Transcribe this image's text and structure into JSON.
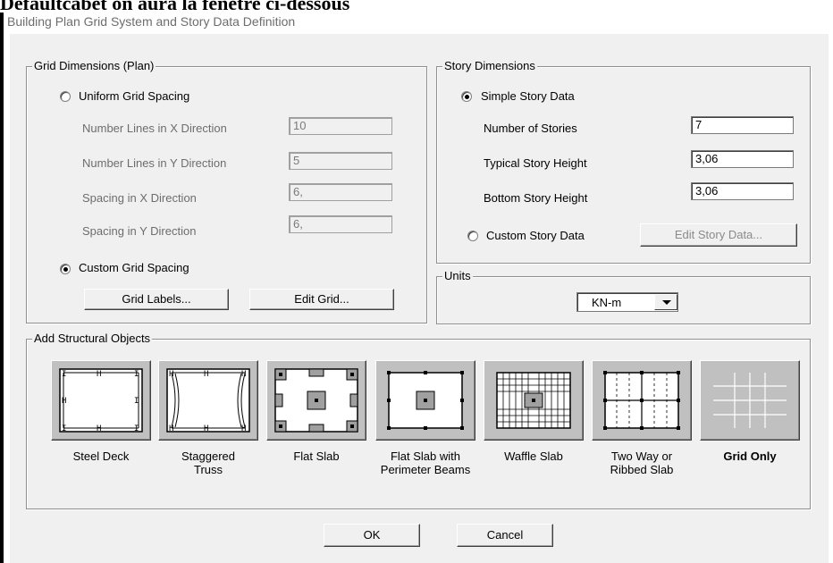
{
  "caption": "Défaultcabet on aura la fenêtre ci-dessous",
  "window_title": "Building Plan Grid System and Story Data Definition",
  "grid_dimensions": {
    "title": "Grid Dimensions (Plan)",
    "uniform_label": "Uniform Grid Spacing",
    "uniform_selected": false,
    "fields": [
      {
        "label": "Number Lines in X Direction",
        "value": "10"
      },
      {
        "label": "Number Lines in Y Direction",
        "value": "5"
      },
      {
        "label": "Spacing in X Direction",
        "value": "6,"
      },
      {
        "label": "Spacing in Y Direction",
        "value": "6,"
      }
    ],
    "custom_label": "Custom Grid Spacing",
    "custom_selected": true,
    "grid_labels_button": "Grid Labels...",
    "edit_grid_button": "Edit Grid..."
  },
  "story_dimensions": {
    "title": "Story Dimensions",
    "simple_label": "Simple Story Data",
    "simple_selected": true,
    "fields": [
      {
        "label": "Number of Stories",
        "value": "7"
      },
      {
        "label": "Typical Story Height",
        "value": "3,06"
      },
      {
        "label": "Bottom Story Height",
        "value": "3,06"
      }
    ],
    "custom_label": "Custom Story Data",
    "custom_selected": false,
    "edit_story_button": "Edit Story Data..."
  },
  "units": {
    "title": "Units",
    "selected": "KN-m"
  },
  "structural_objects": {
    "title": "Add Structural Objects",
    "items": [
      {
        "line1": "Steel Deck",
        "line2": "",
        "icon": "steel-deck-icon"
      },
      {
        "line1": "Staggered",
        "line2": "Truss",
        "icon": "staggered-truss-icon"
      },
      {
        "line1": "Flat Slab",
        "line2": "",
        "icon": "flat-slab-icon"
      },
      {
        "line1": "Flat Slab with",
        "line2": "Perimeter Beams",
        "icon": "flat-slab-perimeter-icon"
      },
      {
        "line1": "Waffle Slab",
        "line2": "",
        "icon": "waffle-slab-icon"
      },
      {
        "line1": "Two Way or",
        "line2": "Ribbed Slab",
        "icon": "ribbed-slab-icon"
      },
      {
        "line1": "Grid Only",
        "line2": "",
        "icon": "grid-only-icon",
        "selected": true
      }
    ]
  },
  "buttons": {
    "ok": "OK",
    "cancel": "Cancel"
  }
}
